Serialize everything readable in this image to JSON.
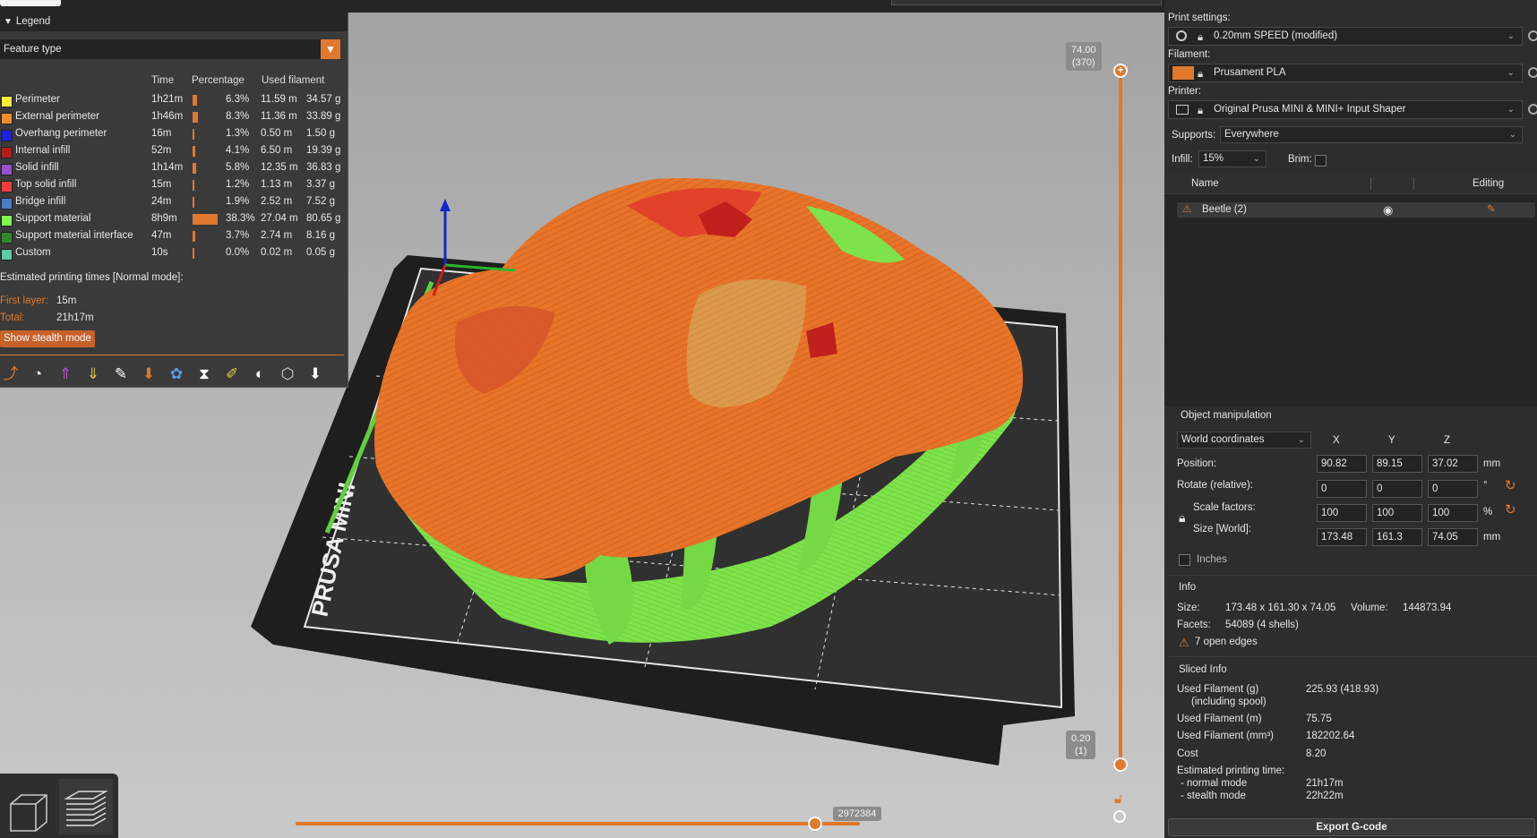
{
  "legend": {
    "title": "Legend",
    "feature_type": "Feature type",
    "headers": {
      "time": "Time",
      "percentage": "Percentage",
      "used_filament": "Used filament"
    },
    "rows": [
      {
        "name": "Perimeter",
        "color": "#ffeb3b",
        "time": "1h21m",
        "pct": "6.3%",
        "pct_value": 0.063,
        "len": "11.59 m",
        "mass": "34.57 g"
      },
      {
        "name": "External perimeter",
        "color": "#f28c28",
        "time": "1h46m",
        "pct": "8.3%",
        "pct_value": 0.083,
        "len": "11.36 m",
        "mass": "33.89 g"
      },
      {
        "name": "Overhang perimeter",
        "color": "#1f1fe6",
        "time": "16m",
        "pct": "1.3%",
        "pct_value": 0.013,
        "len": "0.50 m",
        "mass": "1.50 g"
      },
      {
        "name": "Internal infill",
        "color": "#b31c1c",
        "time": "52m",
        "pct": "4.1%",
        "pct_value": 0.041,
        "len": "6.50 m",
        "mass": "19.39 g"
      },
      {
        "name": "Solid infill",
        "color": "#9a4fd1",
        "time": "1h14m",
        "pct": "5.8%",
        "pct_value": 0.058,
        "len": "12.35 m",
        "mass": "36.83 g"
      },
      {
        "name": "Top solid infill",
        "color": "#f03c3c",
        "time": "15m",
        "pct": "1.2%",
        "pct_value": 0.012,
        "len": "1.13 m",
        "mass": "3.37 g"
      },
      {
        "name": "Bridge infill",
        "color": "#4a7fc8",
        "time": "24m",
        "pct": "1.9%",
        "pct_value": 0.019,
        "len": "2.52 m",
        "mass": "7.52 g"
      },
      {
        "name": "Support material",
        "color": "#7ef84f",
        "time": "8h9m",
        "pct": "38.3%",
        "pct_value": 0.383,
        "len": "27.04 m",
        "mass": "80.65 g"
      },
      {
        "name": "Support material interface",
        "color": "#2f8a2b",
        "time": "47m",
        "pct": "3.7%",
        "pct_value": 0.037,
        "len": "2.74 m",
        "mass": "8.16 g"
      },
      {
        "name": "Custom",
        "color": "#5ecba3",
        "time": "10s",
        "pct": "0.0%",
        "pct_value": 0.0,
        "len": "0.02 m",
        "mass": "0.05 g"
      }
    ],
    "estimated_title": "Estimated printing times [Normal mode]:",
    "first_layer_label": "First layer:",
    "first_layer_value": "15m",
    "total_label": "Total:",
    "total_value": "21h17m",
    "stealth_button": "Show stealth mode",
    "accent": "#e0782d"
  },
  "viewport": {
    "bed_text": "PRUSA MINI",
    "top_layer_value": "74.00",
    "top_layer_index": "(370)",
    "bottom_layer_value": "0.20",
    "bottom_layer_index": "(1)",
    "move_count": "2972384",
    "move_fraction": 0.92
  },
  "sidebar": {
    "print_settings_label": "Print settings:",
    "print_settings_value": "0.20mm SPEED (modified)",
    "filament_label": "Filament:",
    "filament_value": "Prusament PLA",
    "filament_color": "#e0782d",
    "printer_label": "Printer:",
    "printer_value": "Original Prusa MINI & MINI+ Input Shaper",
    "supports_label": "Supports:",
    "supports_value": "Everywhere",
    "infill_label": "Infill:",
    "infill_value": "15%",
    "brim_label": "Brim:",
    "list_name_header": "Name",
    "list_editing_header": "Editing",
    "object_name": "Beetle (2)",
    "object_manipulation": "Object manipulation",
    "coord_system": "World coordinates",
    "axis_x": "X",
    "axis_y": "Y",
    "axis_z": "Z",
    "position_label": "Position:",
    "position": [
      "90.82",
      "89.15",
      "37.02"
    ],
    "position_unit": "mm",
    "rotate_label": "Rotate (relative):",
    "rotate": [
      "0",
      "0",
      "0"
    ],
    "rotate_unit": "°",
    "scale_label": "Scale factors:",
    "scale": [
      "100",
      "100",
      "100"
    ],
    "scale_unit": "%",
    "size_label": "Size [World]:",
    "size": [
      "173.48",
      "161.3",
      "74.05"
    ],
    "size_unit": "mm",
    "inches_label": "Inches",
    "info_title": "Info",
    "info_size_label": "Size:",
    "info_size_value": "173.48 x 161.30 x 74.05",
    "info_volume_label": "Volume:",
    "info_volume_value": "144873.94",
    "info_facets_label": "Facets:",
    "info_facets_value": "54089 (4 shells)",
    "info_open_edges": "7 open edges",
    "sliced_title": "Sliced Info",
    "used_g_label": "Used Filament (g)",
    "used_g_sub": "(including spool)",
    "used_g_value": "225.93 (418.93)",
    "used_m_label": "Used Filament (m)",
    "used_m_value": "75.75",
    "used_mm3_label": "Used Filament (mm³)",
    "used_mm3_value": "182202.64",
    "cost_label": "Cost",
    "cost_value": "8.20",
    "est_time_label": "Estimated printing time:",
    "normal_mode_label": "- normal mode",
    "normal_mode_value": "21h17m",
    "stealth_mode_label": "- stealth mode",
    "stealth_mode_value": "22h22m",
    "export_button": "Export G-code"
  }
}
